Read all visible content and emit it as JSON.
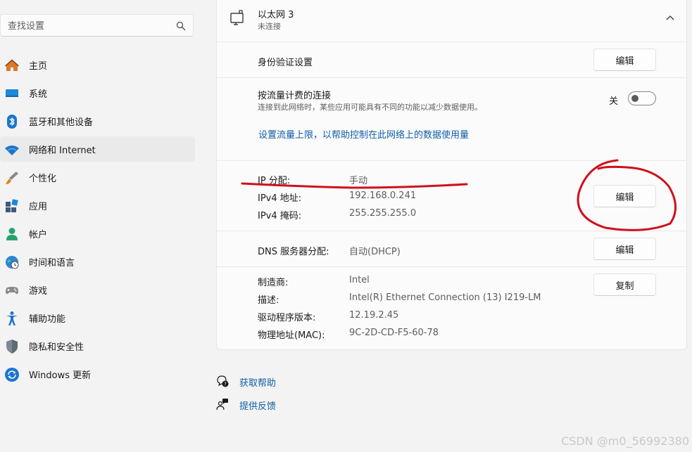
{
  "search": {
    "placeholder": "查找设置"
  },
  "nav": {
    "items": [
      {
        "label": "主页"
      },
      {
        "label": "系统"
      },
      {
        "label": "蓝牙和其他设备"
      },
      {
        "label": "网络和 Internet",
        "active": true
      },
      {
        "label": "个性化"
      },
      {
        "label": "应用"
      },
      {
        "label": "帐户"
      },
      {
        "label": "时间和语言"
      },
      {
        "label": "游戏"
      },
      {
        "label": "辅助功能"
      },
      {
        "label": "隐私和安全性"
      },
      {
        "label": "Windows 更新"
      }
    ]
  },
  "adapter": {
    "name": "以太网 3",
    "status": "未连接",
    "auth_label": "身份验证设置",
    "auth_button": "编辑",
    "metered_title": "按流量计费的连接",
    "metered_desc": "连接到此网络时，某些应用可能具有不同的功能以减少数据使用。",
    "metered_state": "关",
    "metered_on": false,
    "data_limit_link": "设置流量上限，以帮助控制在此网络上的数据使用量",
    "ip": {
      "assign_label": "IP 分配:",
      "assign_value": "手动",
      "ipv4_label": "IPv4 地址:",
      "ipv4_value": "192.168.0.241",
      "mask_label": "IPv4 掩码:",
      "mask_value": "255.255.255.0",
      "button": "编辑"
    },
    "dns": {
      "label": "DNS 服务器分配:",
      "value": "自动(DHCP)",
      "button": "编辑"
    },
    "properties": {
      "manufacturer_label": "制造商:",
      "manufacturer_value": "Intel",
      "desc_label": "描述:",
      "desc_value": "Intel(R) Ethernet Connection (13) I219-LM",
      "driver_label": "驱动程序版本:",
      "driver_value": "12.19.2.45",
      "mac_label": "物理地址(MAC):",
      "mac_value": "9C-2D-CD-F5-60-78",
      "copy_button": "复制"
    }
  },
  "help": {
    "get_help": "获取帮助",
    "feedback": "提供反馈"
  },
  "watermark": "CSDN @m0_56992380",
  "colors": {
    "accent": "#0f5ea8",
    "annotation": "#d0101a",
    "background": "#f3f3f3",
    "card": "#fbfbfb"
  }
}
